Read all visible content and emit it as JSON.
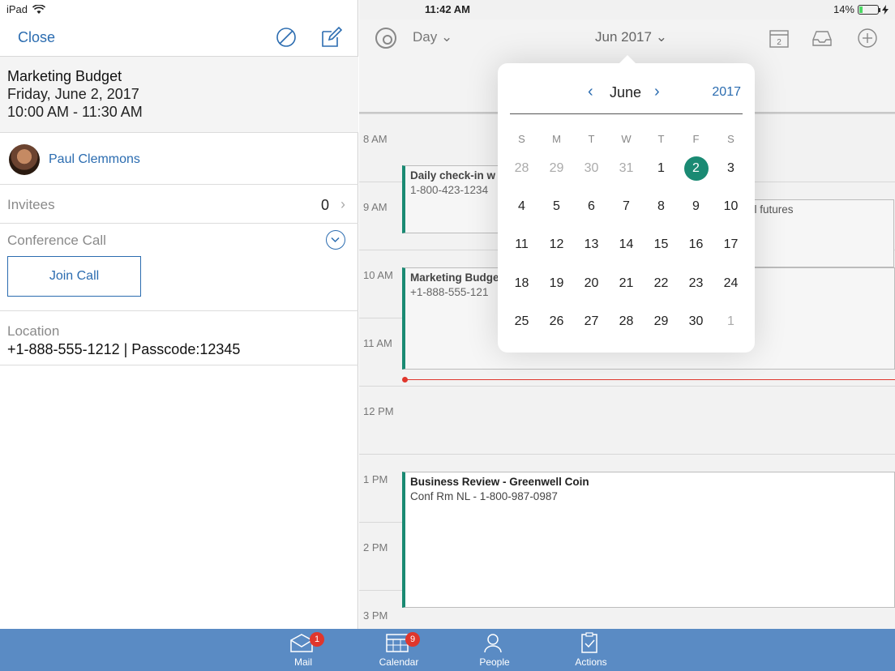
{
  "status": {
    "device": "iPad",
    "time": "11:42 AM",
    "battery": "14%"
  },
  "detail": {
    "close_label": "Close",
    "title": "Marketing Budget",
    "date": "Friday, June 2, 2017",
    "time_range": "10:00 AM - 11:30 AM",
    "organizer": "Paul Clemmons",
    "invitees_label": "Invitees",
    "invitees_count": "0",
    "conference_label": "Conference Call",
    "join_label": "Join Call",
    "location_label": "Location",
    "location_value": "+1-888-555-1212 | Passcode:12345"
  },
  "calendar": {
    "view_label": "Day",
    "month_label": "Jun 2017",
    "today_icon_label": "2",
    "hours": [
      "8 AM",
      "9 AM",
      "10 AM",
      "11 AM",
      "12 PM",
      "1 PM",
      "2 PM",
      "3 PM"
    ],
    "events": [
      {
        "title": "Daily check-in w",
        "sub": "1-800-423-1234"
      },
      {
        "title": "ell futures",
        "sub": ""
      },
      {
        "title": "Marketing Budge",
        "sub": "+1-888-555-121"
      },
      {
        "title": "Business Review - Greenwell Coin",
        "sub": "Conf Rm NL - 1-800-987-0987"
      }
    ]
  },
  "picker": {
    "month": "June",
    "year": "2017",
    "dow": [
      "S",
      "M",
      "T",
      "W",
      "T",
      "F",
      "S"
    ],
    "days": [
      "28",
      "29",
      "30",
      "31",
      "1",
      "2",
      "3",
      "4",
      "5",
      "6",
      "7",
      "8",
      "9",
      "10",
      "11",
      "12",
      "13",
      "14",
      "15",
      "16",
      "17",
      "18",
      "19",
      "20",
      "21",
      "22",
      "23",
      "24",
      "25",
      "26",
      "27",
      "28",
      "29",
      "30",
      "1"
    ],
    "selected_index": 5
  },
  "tabs": [
    {
      "label": "Mail",
      "badge": "1"
    },
    {
      "label": "Calendar",
      "badge": "9"
    },
    {
      "label": "People",
      "badge": ""
    },
    {
      "label": "Actions",
      "badge": ""
    }
  ]
}
